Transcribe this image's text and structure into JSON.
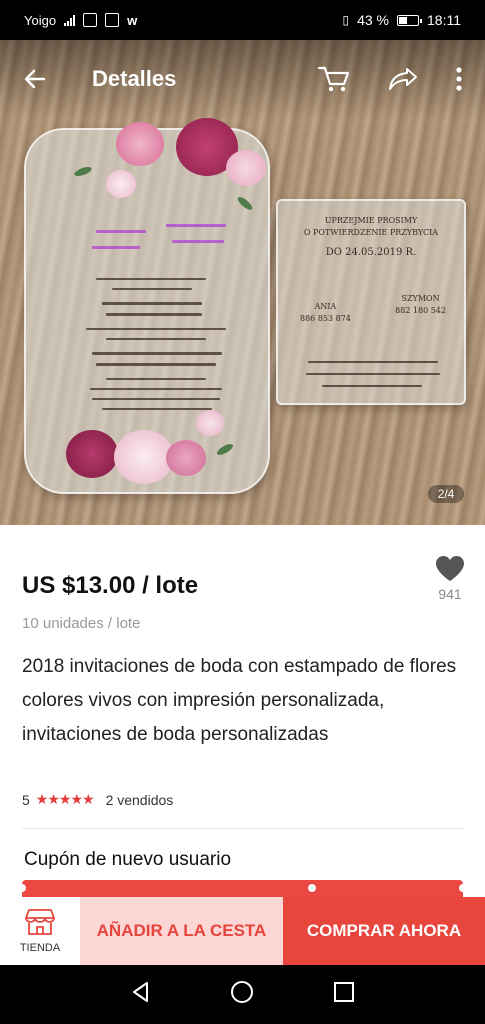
{
  "status_bar": {
    "carrier": "Yoigo",
    "battery": "43 %",
    "time": "18:11"
  },
  "header": {
    "title": "Detalles",
    "back_icon": "arrow-left-icon",
    "cart_icon": "cart-icon",
    "share_icon": "share-icon",
    "more_icon": "more-vertical-icon"
  },
  "gallery": {
    "counter": "2/4",
    "invitation_texts": {
      "names": [
        "Anna",
        "Szymon"
      ],
      "surnames": [
        "Bardyl",
        "Skalski"
      ],
      "rsvp_heading": [
        "UPRZEJMIE PROSIMY",
        "O POTWIERDZENIE PRZYBYCIA"
      ],
      "rsvp_date": "DO 24.05.2019 R.",
      "contacts": [
        {
          "name": "ANIA",
          "phone": "886 853 874"
        },
        {
          "name": "SZYMON",
          "phone": "882 180 542"
        }
      ]
    }
  },
  "product": {
    "price": "US $13.00 / lote",
    "unit_info": "10 unidades / lote",
    "wishlist_count": "941",
    "title": "2018 invitaciones de boda con estampado de flores colores vivos con impresión personalizada, invitaciones de boda personalizadas",
    "rating": "5",
    "stars": "★★★★★",
    "sold": "2 vendidos"
  },
  "coupon": {
    "title": "Cupón de nuevo usuario"
  },
  "actions": {
    "store_label": "TIENDA",
    "add_to_cart": "AÑADIR A LA CESTA",
    "buy_now": "COMPRAR AHORA"
  },
  "colors": {
    "accent": "#e8453d",
    "accent_light": "#fbd6d4",
    "star": "#e43d3d"
  }
}
